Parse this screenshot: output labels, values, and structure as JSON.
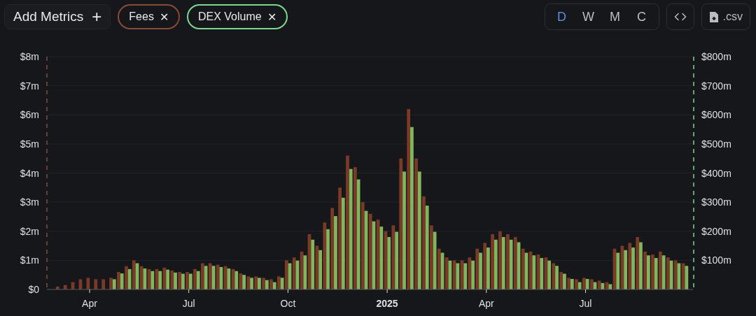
{
  "toolbar": {
    "add_metrics": {
      "label": "Add Metrics",
      "icon": "+"
    },
    "metrics": [
      {
        "color": "#8a4a33",
        "remove": "✕"
      },
      {
        "color": "#7bd88f",
        "remove": "✕"
      }
    ],
    "periods": [
      {
        "label": "D",
        "selected": true
      },
      {
        "label": "W",
        "selected": false
      },
      {
        "label": "M",
        "selected": false
      },
      {
        "label": "C",
        "selected": false
      }
    ],
    "csv": {
      "label": ".csv"
    }
  },
  "chart": {
    "chart_data": {
      "type": "bar",
      "stacked": false,
      "grid": true,
      "categories": [
        null,
        null,
        null,
        null,
        null,
        "Apr",
        null,
        null,
        null,
        null,
        null,
        null,
        null,
        null,
        null,
        null,
        null,
        null,
        "Jul",
        null,
        null,
        null,
        null,
        null,
        null,
        null,
        null,
        null,
        null,
        null,
        null,
        "Oct",
        null,
        null,
        null,
        null,
        null,
        null,
        null,
        null,
        null,
        null,
        null,
        null,
        "2025",
        null,
        null,
        null,
        null,
        null,
        null,
        null,
        null,
        null,
        null,
        null,
        null,
        "Apr",
        null,
        null,
        null,
        null,
        null,
        null,
        null,
        null,
        null,
        null,
        null,
        null,
        "Jul",
        null,
        null,
        null,
        null,
        null,
        null,
        null,
        null,
        null,
        null,
        null,
        null,
        null
      ],
      "ylim": [
        0,
        8
      ],
      "yticks": [
        {
          "value": 0,
          "label": "$0"
        },
        {
          "value": 1,
          "label": "$1m"
        },
        {
          "value": 2,
          "label": "$2m"
        },
        {
          "value": 3,
          "label": "$3m"
        },
        {
          "value": 4,
          "label": "$4m"
        },
        {
          "value": 5,
          "label": "$5m"
        },
        {
          "value": 6,
          "label": "$6m"
        },
        {
          "value": 7,
          "label": "$7m"
        },
        {
          "value": 8,
          "label": "$8m"
        }
      ],
      "y2lim": [
        0,
        800
      ],
      "y2ticks": [
        {
          "value": 100,
          "label": "$100m"
        },
        {
          "value": 200,
          "label": "$200m"
        },
        {
          "value": 300,
          "label": "$300m"
        },
        {
          "value": 400,
          "label": "$400m"
        },
        {
          "value": 500,
          "label": "$500m"
        },
        {
          "value": 600,
          "label": "$600m"
        },
        {
          "value": 700,
          "label": "$700m"
        },
        {
          "value": 800,
          "label": "$800m"
        }
      ],
      "series": [
        {
          "name": "Fees",
          "color": "#7a3a26",
          "values": [
            null,
            0.1,
            0.15,
            0.25,
            0.35,
            0.4,
            0.35,
            0.35,
            0.4,
            0.6,
            0.8,
            1.0,
            0.8,
            0.7,
            0.7,
            0.75,
            0.65,
            0.6,
            0.6,
            0.7,
            0.9,
            0.9,
            0.85,
            0.8,
            0.7,
            0.55,
            0.45,
            0.45,
            0.4,
            0.35,
            0.45,
            1.0,
            1.1,
            1.3,
            1.9,
            1.5,
            2.3,
            2.8,
            3.5,
            4.6,
            4.2,
            3.0,
            2.6,
            2.4,
            2.0,
            2.2,
            4.5,
            6.2,
            4.5,
            3.2,
            2.2,
            1.4,
            1.1,
            1.0,
            1.0,
            1.1,
            1.4,
            1.6,
            1.9,
            2.0,
            1.9,
            1.8,
            1.4,
            1.3,
            1.2,
            1.1,
            0.9,
            0.6,
            0.4,
            0.35,
            0.4,
            0.35,
            0.3,
            0.25,
            1.4,
            1.5,
            1.6,
            1.8,
            1.3,
            1.2,
            1.3,
            1.1,
            1.0,
            0.9
          ]
        },
        {
          "name": "DEX Volume",
          "color": "#7fb65e",
          "axis": "y2",
          "values": [
            null,
            null,
            null,
            null,
            null,
            null,
            null,
            null,
            35,
            55,
            70,
            90,
            72,
            63,
            63,
            68,
            58,
            54,
            54,
            63,
            81,
            81,
            77,
            72,
            63,
            50,
            40,
            40,
            32,
            25,
            40,
            90,
            99,
            117,
            171,
            135,
            207,
            252,
            315,
            414,
            378,
            270,
            234,
            216,
            180,
            198,
            405,
            558,
            405,
            288,
            198,
            126,
            99,
            90,
            90,
            99,
            126,
            144,
            171,
            180,
            171,
            162,
            126,
            117,
            108,
            99,
            81,
            54,
            36,
            25,
            36,
            25,
            22,
            18,
            126,
            135,
            144,
            162,
            117,
            108,
            117,
            99,
            90,
            81
          ]
        }
      ]
    }
  }
}
